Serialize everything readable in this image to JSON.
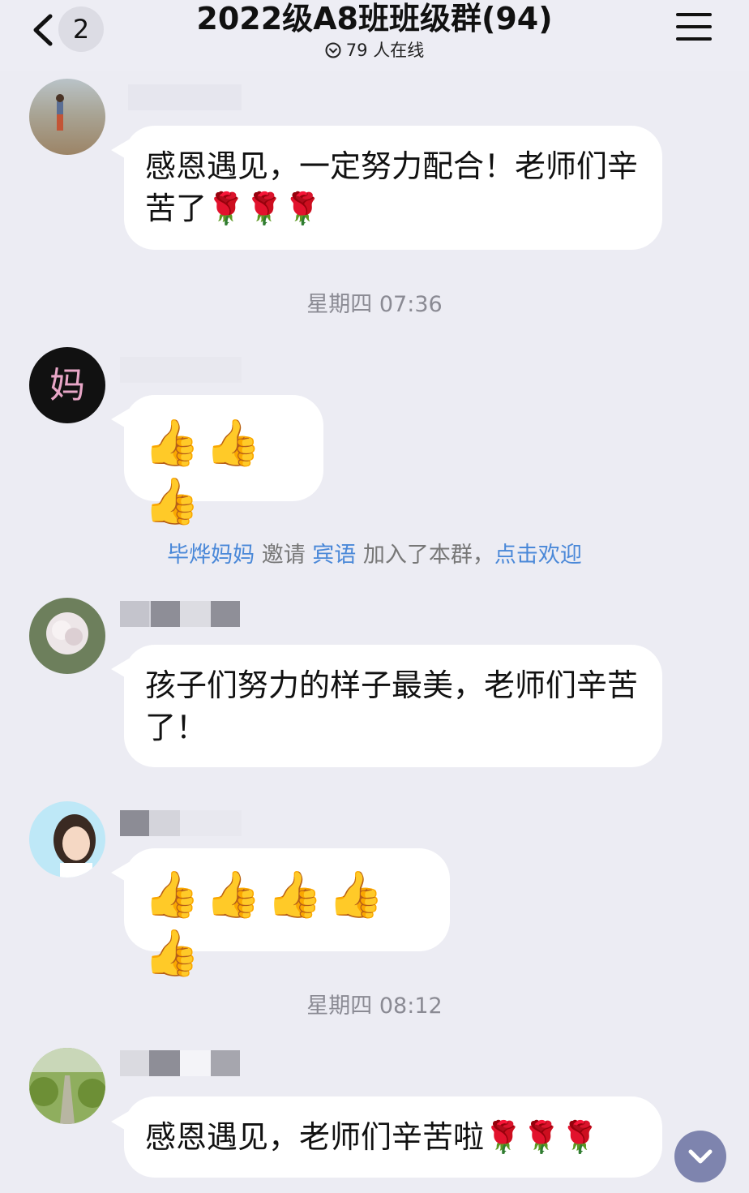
{
  "header": {
    "back_count": "2",
    "title": "2022级A8班班级群(94)",
    "online_text": "79 人在线"
  },
  "messages": [
    {
      "type": "text",
      "text": "感恩遇见，一定努力配合！老师们辛苦了🌹🌹🌹"
    },
    {
      "type": "timestamp",
      "text": "星期四 07:36"
    },
    {
      "type": "emoji",
      "text": "👍👍👍"
    },
    {
      "type": "system",
      "inviter": "毕烨妈妈",
      "action": "邀请",
      "invitee": "宾语",
      "joined": "加入了本群，",
      "welcome": "点击欢迎"
    },
    {
      "type": "text",
      "text": "孩子们努力的样子最美，老师们辛苦了！"
    },
    {
      "type": "emoji",
      "text": "👍👍👍👍👍"
    },
    {
      "type": "timestamp",
      "text": "星期四 08:12"
    },
    {
      "type": "text",
      "text": "感恩遇见，老师们辛苦啦🌹🌹🌹"
    }
  ],
  "colors": {
    "background": "#ECECF3",
    "bubble": "#FFFFFF",
    "link": "#4A88D8",
    "timestamp": "#8A8A93",
    "scroll_button": "#7E84AE"
  },
  "icons": [
    "back-chevron-icon",
    "online-status-icon",
    "menu-icon",
    "scroll-down-icon"
  ]
}
